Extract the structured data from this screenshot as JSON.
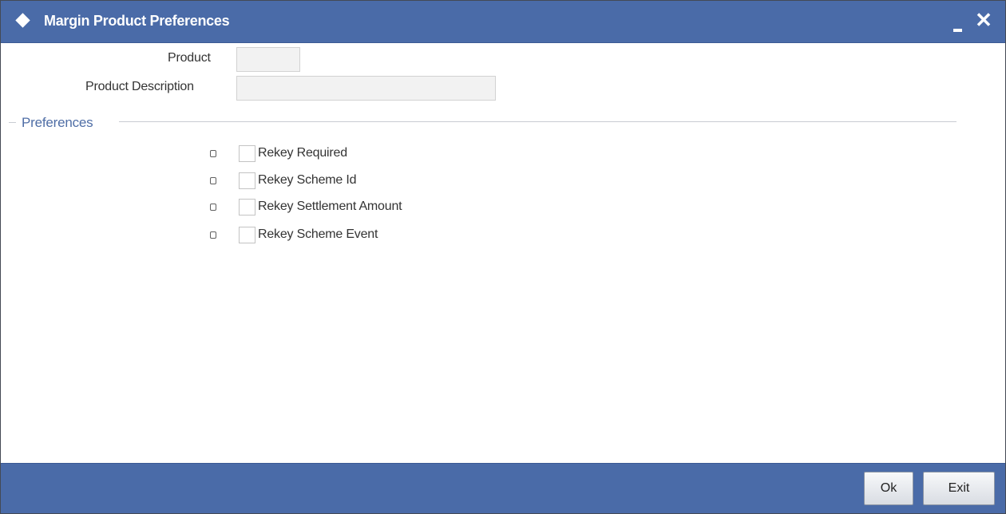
{
  "window": {
    "title": "Margin Product Preferences"
  },
  "fields": {
    "product_label": "Product",
    "product_value": "",
    "description_label": "Product Description",
    "description_value": ""
  },
  "preferences": {
    "section_title": "Preferences",
    "items": [
      {
        "label": "Rekey Required",
        "checked": false
      },
      {
        "label": "Rekey Scheme Id",
        "checked": false
      },
      {
        "label": "Rekey Settlement Amount",
        "checked": false
      },
      {
        "label": "Rekey Scheme Event",
        "checked": false
      }
    ]
  },
  "footer": {
    "ok_label": "Ok",
    "exit_label": "Exit"
  },
  "colors": {
    "titlebar": "#4a6ba8",
    "section_title": "#4f6ea6",
    "field_bg": "#f2f2f2"
  },
  "icons": {
    "title": "diamond-icon",
    "minimize": "minimize-icon",
    "close": "close-icon"
  }
}
